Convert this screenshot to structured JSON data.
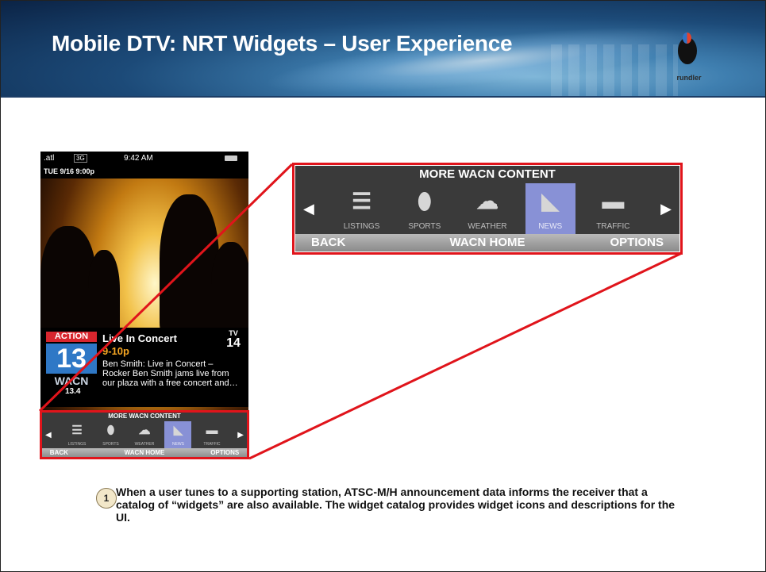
{
  "slide": {
    "title": "Mobile DTV: NRT Widgets – User Experience",
    "logo_text": "rundler",
    "bullet_number": "1",
    "paragraph": "When a user tunes to a supporting station, ATSC-M/H announcement data informs the receiver that a catalog of “widgets” are also available.  The widget catalog provides widget icons and descriptions for the UI."
  },
  "phone": {
    "status_signal": ".atl",
    "status_network": "3G",
    "status_time": "9:42 AM",
    "date_line": "TUE   9/16  9:00p",
    "channel": {
      "brand": "ACTION",
      "number": "13",
      "callsign": "WACN",
      "subchannel": "13.4"
    },
    "program": {
      "title": "Live In Concert",
      "time": "9-10p",
      "description": "Ben Smith: Live in Concert – Rocker Ben Smith jams live from our plaza with a free concert and…"
    },
    "rating": {
      "tv": "TV",
      "value": "14"
    }
  },
  "widget_bar": {
    "title": "MORE  WACN CONTENT",
    "items": [
      {
        "label": "LISTINGS",
        "icon": "listings-icon",
        "glyph": "☰",
        "active": false
      },
      {
        "label": "SPORTS",
        "icon": "football-icon",
        "glyph": "⬮",
        "active": false
      },
      {
        "label": "WEATHER",
        "icon": "partly-cloudy-icon",
        "glyph": "☁",
        "active": false
      },
      {
        "label": "NEWS",
        "icon": "rss-feed-icon",
        "glyph": "◣",
        "active": true
      },
      {
        "label": "TRAFFIC",
        "icon": "car-icon",
        "glyph": "▬",
        "active": false
      }
    ],
    "back_label": "BACK",
    "home_label": "WACN HOME",
    "options_label": "OPTIONS",
    "accent_color": "#8891d6"
  },
  "colors": {
    "highlight_border": "#e0141b",
    "banner_dark": "#0b2345",
    "channel_red": "#d8262e",
    "channel_blue": "#2f78c6",
    "time_orange": "#f5a623"
  }
}
